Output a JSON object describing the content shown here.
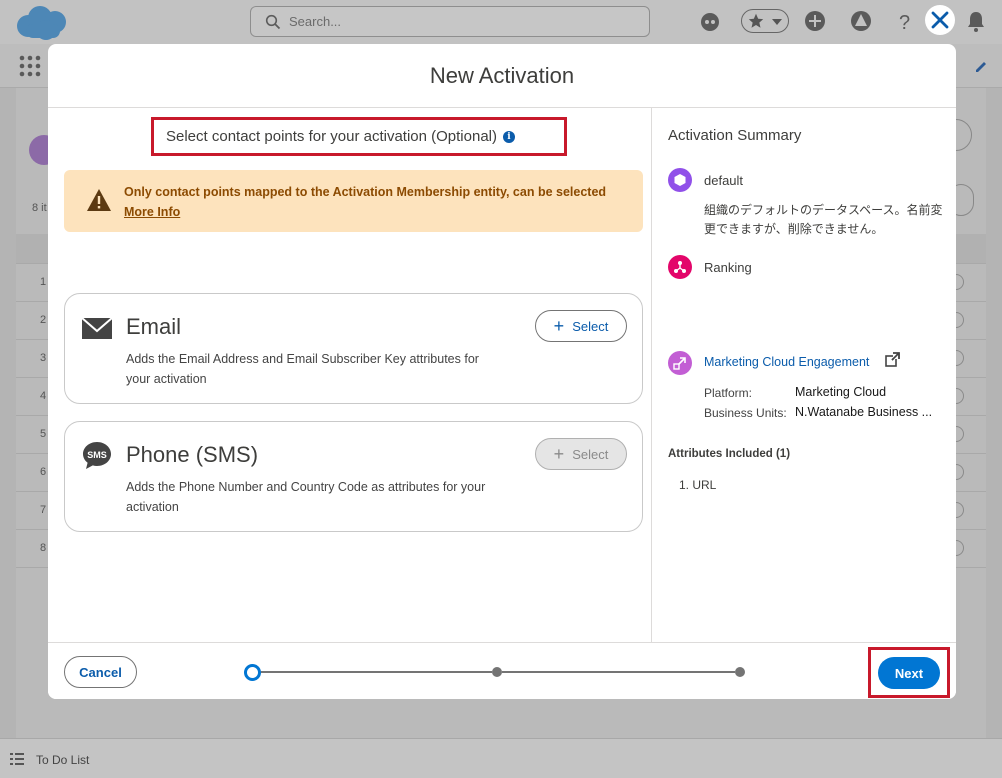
{
  "header": {
    "search_placeholder": "Search...",
    "close_label": "Close"
  },
  "background": {
    "row_numbers": [
      "1",
      "2",
      "3",
      "4",
      "5",
      "6",
      "7",
      "8"
    ],
    "left_count_label": "8 it",
    "todo_label": "To Do List"
  },
  "modal": {
    "title": "New Activation",
    "step_title": "Select contact points for your activation (Optional)",
    "info_icon_glyph": "i",
    "warning": {
      "text": "Only contact points mapped to the Activation Membership entity, can be selected",
      "link": "More Info"
    },
    "cards": [
      {
        "icon": "envelope-icon",
        "title": "Email",
        "description": "Adds the Email Address and Email Subscriber Key attributes for your activation",
        "button": "Select",
        "button_disabled": false
      },
      {
        "icon": "sms-icon",
        "title": "Phone (SMS)",
        "description": "Adds the Phone Number and Country Code as attributes for your activation",
        "button": "Select",
        "button_disabled": true
      }
    ],
    "summary": {
      "title": "Activation Summary",
      "dataspace_name": "default",
      "dataspace_desc": "組織のデフォルトのデータスペース。名前変更できますが、削除できません。",
      "segment_name": "Ranking",
      "target_name": "Marketing Cloud Engagement",
      "platform_label": "Platform:",
      "platform_value": "Marketing Cloud",
      "bu_label": "Business Units:",
      "bu_value": "N.Watanabe Business ...",
      "attributes_heading": "Attributes Included (1)",
      "attributes": [
        "1. URL"
      ]
    },
    "footer": {
      "cancel": "Cancel",
      "next": "Next",
      "steps_total": 3,
      "current_step": 1
    }
  },
  "colors": {
    "brand_blue": "#0176d3",
    "link_blue": "#0b5cab",
    "highlight_red": "#c8192b",
    "warning_bg": "#fde3bd",
    "dataspace_purple": "#9050e9",
    "segment_pink": "#e3066a",
    "target_purple": "#c25ed4"
  }
}
